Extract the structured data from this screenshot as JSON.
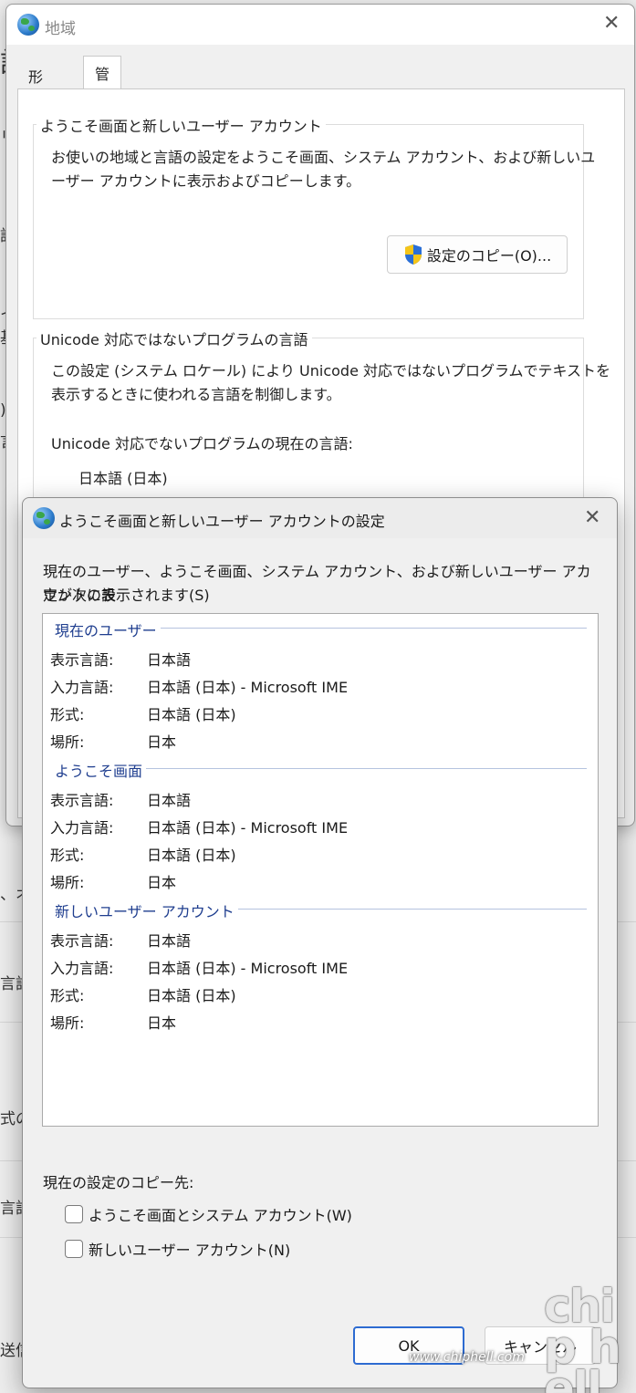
{
  "background": {
    "fragments": [
      "語",
      "リ",
      "語",
      "イ",
      "基",
      ")",
      "言",
      "、オ",
      "言語",
      "式の",
      "言語",
      "送信"
    ]
  },
  "region_window": {
    "title": "地域",
    "tabs": [
      "形式",
      "管理"
    ],
    "welcome_group": {
      "title": "ようこそ画面と新しいユーザー アカウント",
      "text_line1": "お使いの地域と言語の設定をようこそ画面、システム アカウント、および新しいユ",
      "text_line2": "ーザー アカウントに表示およびコピーします。",
      "copy_button": "設定のコピー(O)..."
    },
    "unicode_group": {
      "title": "Unicode 対応ではないプログラムの言語",
      "text_line1": "この設定 (システム ロケール) により Unicode 対応ではないプログラムでテキストを",
      "text_line2": "表示するときに使われる言語を制御します。",
      "current_label": "Unicode 対応でないプログラムの現在の言語:",
      "current_value": "日本語 (日本)"
    }
  },
  "dialog": {
    "title": "ようこそ画面と新しいユーザー アカウントの設定",
    "description_line1": "現在のユーザー、ようこそ画面、システム アカウント、および新しいユーザー アカウントの設",
    "description_line2": "定が次に表示されます(S)",
    "sections": [
      {
        "heading": "現在のユーザー",
        "rows": [
          {
            "label": "表示言語:",
            "value": "日本語"
          },
          {
            "label": "入力言語:",
            "value": "日本語 (日本) - Microsoft IME"
          },
          {
            "label": "形式:",
            "value": "日本語 (日本)"
          },
          {
            "label": "場所:",
            "value": "日本"
          }
        ]
      },
      {
        "heading": "ようこそ画面",
        "rows": [
          {
            "label": "表示言語:",
            "value": "日本語"
          },
          {
            "label": "入力言語:",
            "value": "日本語 (日本) - Microsoft IME"
          },
          {
            "label": "形式:",
            "value": "日本語 (日本)"
          },
          {
            "label": "場所:",
            "value": "日本"
          }
        ]
      },
      {
        "heading": "新しいユーザー アカウント",
        "rows": [
          {
            "label": "表示言語:",
            "value": "日本語"
          },
          {
            "label": "入力言語:",
            "value": "日本語 (日本) - Microsoft IME"
          },
          {
            "label": "形式:",
            "value": "日本語 (日本)"
          },
          {
            "label": "場所:",
            "value": "日本"
          }
        ]
      }
    ],
    "copy_to_label": "現在の設定のコピー先:",
    "checkboxes": [
      {
        "label": "ようこそ画面とシステム アカウント(W)",
        "checked": false
      },
      {
        "label": "新しいユーザー アカウント(N)",
        "checked": false
      }
    ],
    "ok_button": "OK",
    "cancel_button": "キャンセル"
  },
  "watermark": {
    "url": "www.chiphell.com",
    "logo": "chip hell"
  },
  "colors": {
    "section_heading": "#1f3e8f",
    "ok_border": "#2d6bd1",
    "shield_blue": "#2a6fd6",
    "shield_yellow": "#f5c518"
  },
  "icons": {
    "window_icon": "globe-icon",
    "close": "close-icon",
    "uac": "uac-shield-icon"
  }
}
